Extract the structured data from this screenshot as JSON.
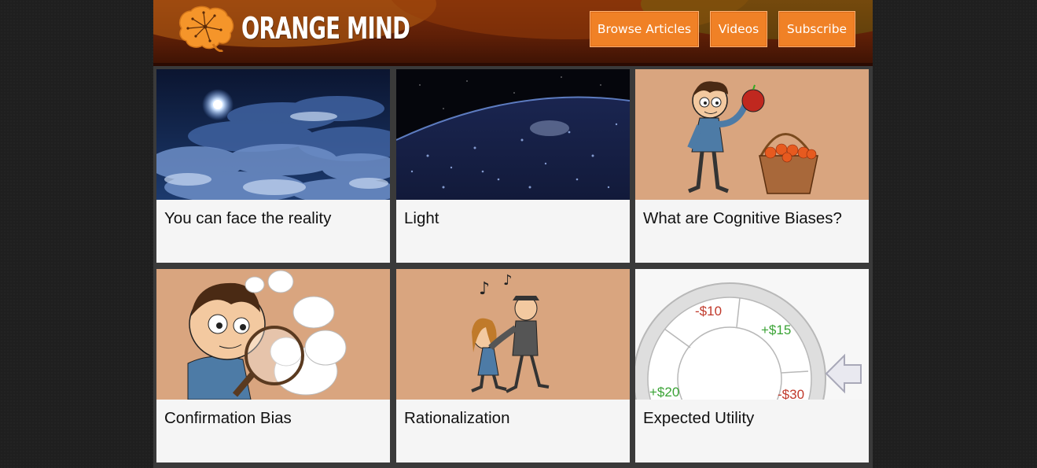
{
  "site": {
    "name": "ORANGE MIND"
  },
  "nav": {
    "items": [
      {
        "label": "Browse Articles"
      },
      {
        "label": "Videos"
      },
      {
        "label": "Subscribe"
      }
    ]
  },
  "cards": [
    {
      "title": "You can face the reality",
      "thumb": "night-clouds-moon"
    },
    {
      "title": "Light",
      "thumb": "city-lights-from-space"
    },
    {
      "title": "What are Cognitive Biases?",
      "thumb": "cartoon-man-with-apple-basket"
    },
    {
      "title": "Confirmation Bias",
      "thumb": "cartoon-man-magnifying-glass-clouds"
    },
    {
      "title": "Rationalization",
      "thumb": "cartoon-couple-dancing"
    },
    {
      "title": "Expected Utility",
      "thumb": "money-wheel",
      "wheel_labels": [
        "-$10",
        "+$15",
        "+$20",
        "-$30"
      ]
    }
  ],
  "colors": {
    "accent": "#f08126",
    "header": "#5e1f07",
    "positive": "#3aa335",
    "negative": "#c0392b"
  }
}
